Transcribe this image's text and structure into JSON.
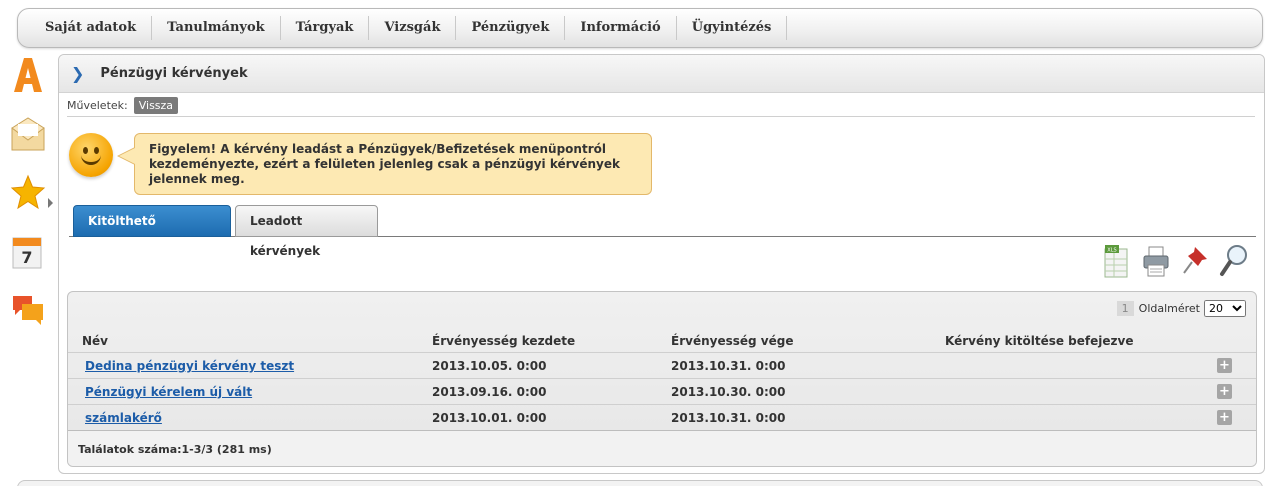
{
  "nav": {
    "items": [
      "Saját adatok",
      "Tanulmányok",
      "Tárgyak",
      "Vizsgák",
      "Pénzügyek",
      "Információ",
      "Ügyintézés"
    ]
  },
  "panel": {
    "title": "Pénzügyi kérvények"
  },
  "operations": {
    "label": "Műveletek:",
    "back_button": "Vissza"
  },
  "notice": {
    "text": "Figyelem! A kérvény leadást a Pénzügyek/Befizetések menüpontról kezdeményezte, ezért a felületen jelenleg csak a pénzügyi kérvények jelennek meg."
  },
  "tabs": [
    {
      "label": "Kitölthető kérvények",
      "active": true
    },
    {
      "label": "Leadott kérvények",
      "active": false
    }
  ],
  "toolbar": {
    "icons": [
      "excel-export-icon",
      "print-icon",
      "pin-icon",
      "search-icon"
    ]
  },
  "grid": {
    "page_number": "1",
    "page_size_label": "Oldalméret",
    "page_size_value": "20",
    "columns": [
      "Név",
      "Érvényesség kezdete",
      "Érvényesség vége",
      "Kérvény kitöltése befejezve"
    ],
    "rows": [
      {
        "name": "Dedina pénzügyi kérvény teszt",
        "start": "2013.10.05. 0:00",
        "end": "2013.10.31. 0:00",
        "completed": ""
      },
      {
        "name": "Pénzügyi kérelem  új vált",
        "start": "2013.09.16. 0:00",
        "end": "2013.10.30. 0:00",
        "completed": ""
      },
      {
        "name": "számlakérő",
        "start": "2013.10.01. 0:00",
        "end": "2013.10.31. 0:00",
        "completed": ""
      }
    ],
    "footer": "Találatok száma:1-3/3 (281 ms)"
  },
  "colors": {
    "accent": "#1d6cb0",
    "link": "#1c5ca8",
    "notice_bg": "#fde9b3",
    "notice_border": "#e3b86a"
  }
}
